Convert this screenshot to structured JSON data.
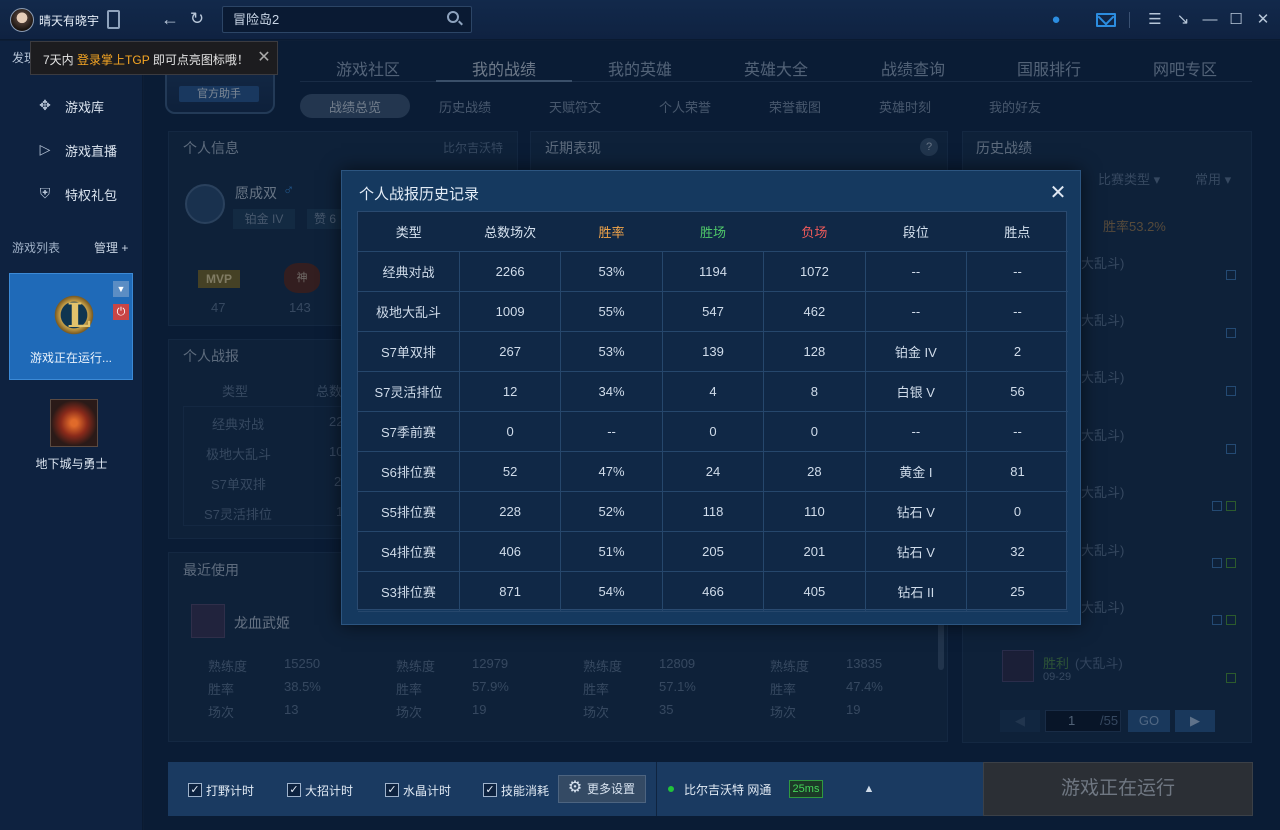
{
  "topbar": {
    "username": "晴天有晓宇",
    "search_value": "冒险岛2"
  },
  "tip": {
    "prefix": "7天内",
    "highlight": "登录掌上TGP",
    "suffix": "即可点亮图标哦！",
    "hidden_tab": "发现"
  },
  "sidebar": {
    "items": [
      {
        "label": "游戏库",
        "icon": "move-icon"
      },
      {
        "label": "游戏直播",
        "icon": "play-icon"
      },
      {
        "label": "特权礼包",
        "icon": "shield-icon"
      }
    ],
    "games_title": "游戏列表",
    "manage_label": "管理 +",
    "games": [
      {
        "label": "游戏正在运行...",
        "logo": "L"
      },
      {
        "label": "地下城与勇士"
      }
    ]
  },
  "main": {
    "logo_text": "官方助手",
    "tabs": [
      "游戏社区",
      "我的战绩",
      "我的英雄",
      "英雄大全",
      "战绩查询",
      "国服排行",
      "网吧专区"
    ],
    "subtabs": [
      "战绩总览",
      "历史战绩",
      "天赋符文",
      "个人荣誉",
      "荣誉截图",
      "英雄时刻",
      "我的好友"
    ],
    "info_panel": {
      "title": "个人信息",
      "server": "比尔吉沃特",
      "name": "愿成双",
      "rank": "铂金 IV",
      "praise": "赞 6",
      "mvp_label": "MVP",
      "mvp_count": "47",
      "badge_label": "神",
      "badge_count": "143"
    },
    "recent_panel": {
      "title": "近期表现",
      "help": "?"
    },
    "report_panel": {
      "title": "个人战报",
      "header_type": "类型",
      "header_total": "总数",
      "rows": [
        {
          "type": "经典对战",
          "total": "22"
        },
        {
          "type": "极地大乱斗",
          "total": "10"
        },
        {
          "type": "S7单双排",
          "total": "2"
        },
        {
          "type": "S7灵活排位",
          "total": "1"
        }
      ]
    },
    "recent_used": {
      "title": "最近使用",
      "label_prof": "熟练度",
      "label_rate": "胜率",
      "label_games": "场次",
      "heroes": [
        {
          "name": "龙血武姬",
          "prof": "15250",
          "rate": "38.5%",
          "games": "13"
        },
        {
          "name": "",
          "prof": "12979",
          "rate": "57.9%",
          "games": "19"
        },
        {
          "name": "",
          "prof": "12809",
          "rate": "57.1%",
          "games": "35"
        },
        {
          "name": "",
          "prof": "13835",
          "rate": "47.4%",
          "games": "19"
        }
      ]
    },
    "history_panel": {
      "title": "历史战绩",
      "filter_type": "比赛类型",
      "filter_common": "常用",
      "win_rate": "胜率53.2%",
      "entry_suffix": "大乱斗)",
      "last_result": "胜利",
      "last_mode": "(大乱斗)",
      "last_date": "09-29",
      "page_value": "1",
      "page_total": "/55",
      "go_label": "GO"
    }
  },
  "bottombar": {
    "checks": [
      "打野计时",
      "大招计时",
      "水晶计时",
      "技能消耗"
    ],
    "more_settings": "更多设置",
    "network": "比尔吉沃特 网通",
    "ping": "25ms",
    "launch": "游戏正在运行"
  },
  "modal": {
    "title": "个人战报历史记录",
    "headers": [
      "类型",
      "总数场次",
      "胜率",
      "胜场",
      "负场",
      "段位",
      "胜点"
    ],
    "header_colors": [
      "#d6e2ef",
      "#d6e2ef",
      "#f2a54a",
      "#4fc86a",
      "#ef5a5a",
      "#d6e2ef",
      "#d6e2ef"
    ],
    "rows": [
      [
        "经典对战",
        "2266",
        "53%",
        "1194",
        "1072",
        "--",
        "--"
      ],
      [
        "极地大乱斗",
        "1009",
        "55%",
        "547",
        "462",
        "--",
        "--"
      ],
      [
        "S7单双排",
        "267",
        "53%",
        "139",
        "128",
        "铂金 IV",
        "2"
      ],
      [
        "S7灵活排位",
        "12",
        "34%",
        "4",
        "8",
        "白银 V",
        "56"
      ],
      [
        "S7季前赛",
        "0",
        "--",
        "0",
        "0",
        "--",
        "--"
      ],
      [
        "S6排位赛",
        "52",
        "47%",
        "24",
        "28",
        "黄金 I",
        "81"
      ],
      [
        "S5排位赛",
        "228",
        "52%",
        "118",
        "110",
        "钻石 V",
        "0"
      ],
      [
        "S4排位赛",
        "406",
        "51%",
        "205",
        "201",
        "钻石 V",
        "32"
      ],
      [
        "S3排位赛",
        "871",
        "54%",
        "466",
        "405",
        "钻石 II",
        "25"
      ]
    ]
  }
}
